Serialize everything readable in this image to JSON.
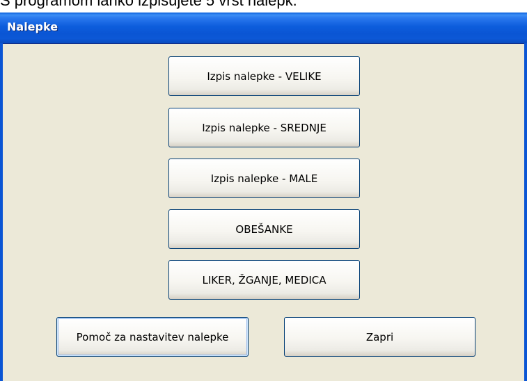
{
  "background_caption": "S programom lahko izpisujete 5 vrst nalepk.",
  "window": {
    "title": "Nalepke"
  },
  "buttons": {
    "velike": "Izpis nalepke - VELIKE",
    "srednje": "Izpis nalepke - SREDNJE",
    "male": "Izpis nalepke - MALE",
    "obesanke": "OBEŠANKE",
    "liker": "LIKER, ŽGANJE, MEDICA",
    "help": "Pomoč za nastavitev nalepke",
    "close": "Zapri"
  },
  "colors": {
    "titlebar": "#0a55d4",
    "window_background": "#ece9d8",
    "button_border": "#003c74"
  }
}
